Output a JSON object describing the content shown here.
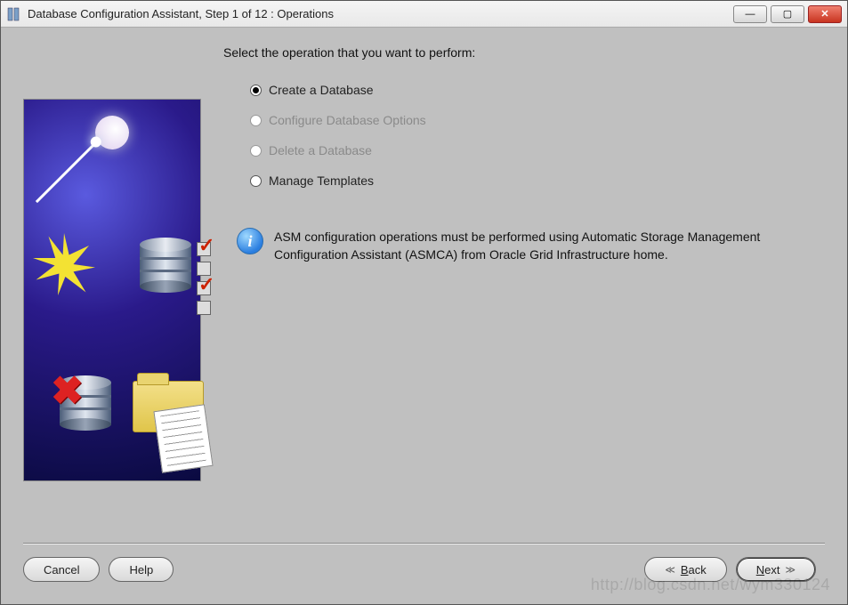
{
  "window": {
    "title": "Database Configuration Assistant, Step 1 of 12 : Operations"
  },
  "prompt": "Select the operation that you want to perform:",
  "options": [
    {
      "label": "Create a Database",
      "selected": true,
      "enabled": true
    },
    {
      "label": "Configure Database Options",
      "selected": false,
      "enabled": false
    },
    {
      "label": "Delete a Database",
      "selected": false,
      "enabled": false
    },
    {
      "label": "Manage Templates",
      "selected": false,
      "enabled": true
    }
  ],
  "info": {
    "text": "ASM configuration operations must be performed using Automatic Storage Management Configuration Assistant (ASMCA) from Oracle Grid Infrastructure home."
  },
  "buttons": {
    "cancel": "Cancel",
    "help": "Help",
    "back": "Back",
    "next": "Next"
  },
  "watermark": "http://blog.csdn.net/wym330124"
}
